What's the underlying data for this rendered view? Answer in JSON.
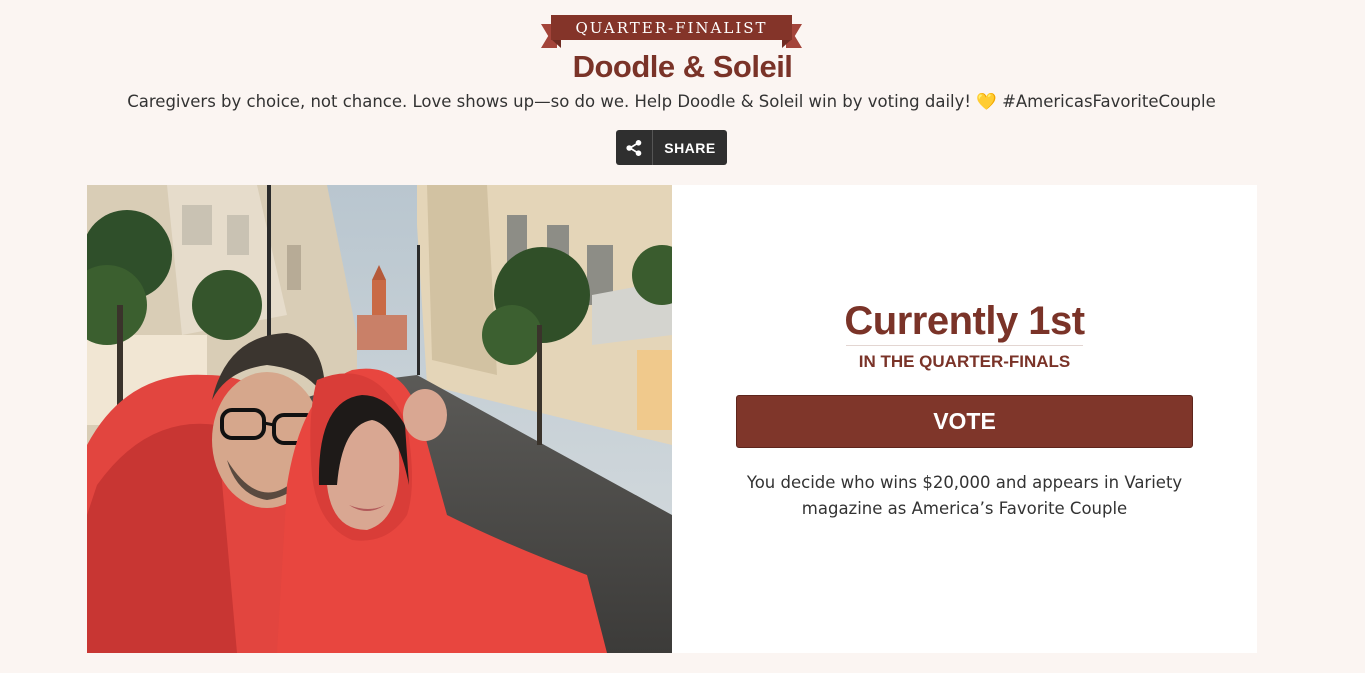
{
  "header": {
    "badge": "QUARTER-FINALIST",
    "name": "Doodle & Soleil",
    "tagline": "Caregivers by choice, not chance. Love shows up—so do we. Help Doodle & Soleil win by voting daily!",
    "tagline_emoji": "💛",
    "tagline_hashtag": "#AmericasFavoriteCouple"
  },
  "share": {
    "label": "SHARE",
    "icon": "share-icon"
  },
  "photo": {
    "icon": "couple-photo"
  },
  "panel": {
    "rank": "Currently 1st",
    "round": "IN THE QUARTER-FINALS",
    "vote_label": "VOTE",
    "description": "You decide who wins $20,000 and appears in Variety magazine as America’s Favorite Couple"
  },
  "colors": {
    "background": "#fbf5f2",
    "brand": "#7a3328",
    "button": "#7f362a",
    "share_bg": "#2f2f2f"
  }
}
